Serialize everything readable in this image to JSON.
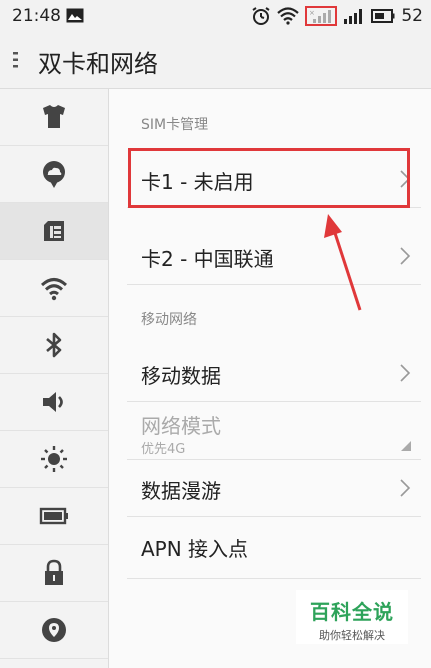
{
  "status_bar": {
    "time": "21:48",
    "battery_level": "52",
    "icons": [
      "image-icon",
      "alarm-icon",
      "wifi-icon",
      "no-sim-signal-icon",
      "signal-icon",
      "battery-icon"
    ]
  },
  "title_bar": {
    "title": "双卡和网络"
  },
  "sidebar": {
    "items": [
      {
        "icon": "theme-shirt-icon"
      },
      {
        "icon": "cloud-icon"
      },
      {
        "icon": "sim-card-icon",
        "active": true
      },
      {
        "icon": "wifi-icon"
      },
      {
        "icon": "bluetooth-icon"
      },
      {
        "icon": "speaker-icon"
      },
      {
        "icon": "brightness-icon"
      },
      {
        "icon": "battery-icon"
      },
      {
        "icon": "lock-icon"
      },
      {
        "icon": "location-icon"
      }
    ]
  },
  "main": {
    "sim_section": "SIM卡管理",
    "sim1": "卡1 - 未启用",
    "sim2": "卡2 - 中国联通",
    "mobile_section": "移动网络",
    "mobile_data": "移动数据",
    "network_mode": "网络模式",
    "network_mode_value": "优先4G",
    "roaming": "数据漫游",
    "apn": "APN 接入点"
  },
  "watermark": {
    "main": "百科全说",
    "sub": "助你轻松解决"
  },
  "colors": {
    "annotation_red": "#e0383a",
    "watermark_green": "#2ea35a"
  }
}
